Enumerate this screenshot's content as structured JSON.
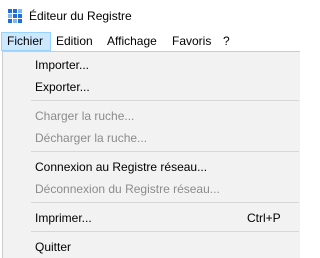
{
  "window": {
    "title": "Éditeur du Registre",
    "icon": "registry-editor-icon"
  },
  "menubar": {
    "items": [
      {
        "label": "Fichier",
        "active": true
      },
      {
        "label": "Edition"
      },
      {
        "label": "Affichage"
      },
      {
        "label": "Favoris"
      },
      {
        "label": "?"
      }
    ]
  },
  "file_menu": {
    "import": "Importer...",
    "export": "Exporter...",
    "load_hive": "Charger la ruche...",
    "unload_hive": "Décharger la ruche...",
    "connect_network": "Connexion au Registre réseau...",
    "disconnect_network": "Déconnexion du Registre réseau...",
    "print": "Imprimer...",
    "print_shortcut": "Ctrl+P",
    "quit": "Quitter"
  }
}
